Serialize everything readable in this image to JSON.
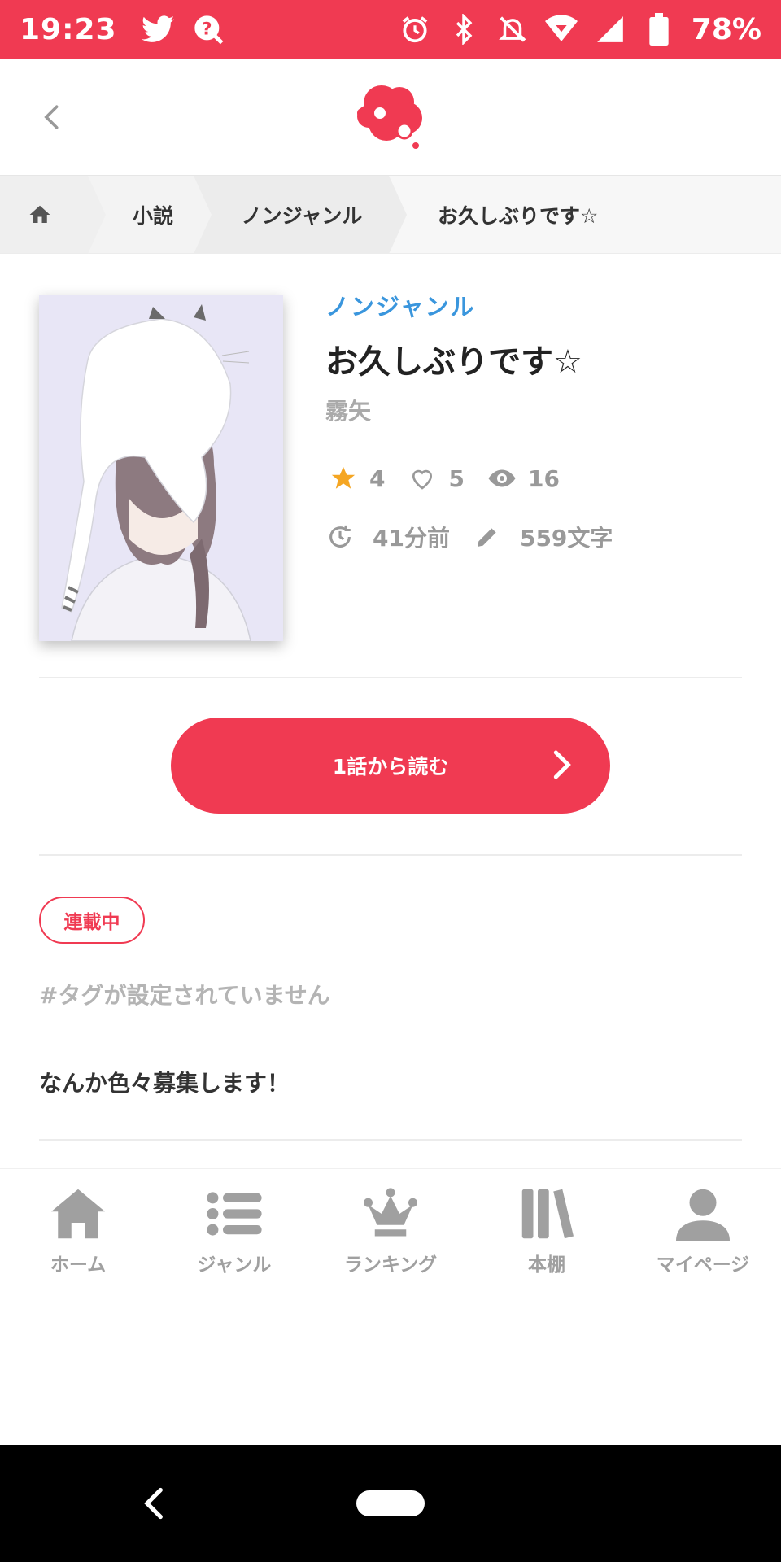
{
  "status_bar": {
    "time": "19:23",
    "battery": "78%",
    "left_icons": [
      "twitter-icon",
      "app-notification-icon"
    ],
    "right_icons": [
      "alarm-icon",
      "bluetooth-icon",
      "notifications-off-icon",
      "wifi-icon",
      "signal-icon",
      "battery-icon"
    ],
    "color": "#f03a52"
  },
  "header": {
    "back_icon": "chevron-left-icon",
    "logo": "app-logo"
  },
  "breadcrumb": {
    "home_icon": "home-icon",
    "items": [
      "小説",
      "ノンジャンル",
      "お久しぶりです☆"
    ]
  },
  "work": {
    "genre": "ノンジャンル",
    "title": "お久しぶりです☆",
    "author": "霧矢",
    "stars": "4",
    "likes": "5",
    "views": "16",
    "updated": "41分前",
    "length": "559文字",
    "status": "連載中",
    "tags": "#タグが設定されていません",
    "description": "なんか色々募集します！"
  },
  "read_button": {
    "label": "1話から読む"
  },
  "bottom_nav": {
    "items": [
      {
        "label": "ホーム",
        "icon": "home-icon"
      },
      {
        "label": "ジャンル",
        "icon": "list-icon"
      },
      {
        "label": "ランキング",
        "icon": "crown-icon"
      },
      {
        "label": "本棚",
        "icon": "bookshelf-icon"
      },
      {
        "label": "マイページ",
        "icon": "person-icon"
      }
    ]
  },
  "colors": {
    "accent": "#f03a52",
    "genre_link": "#3a96dd",
    "star": "#f5a623",
    "muted": "#999999"
  }
}
